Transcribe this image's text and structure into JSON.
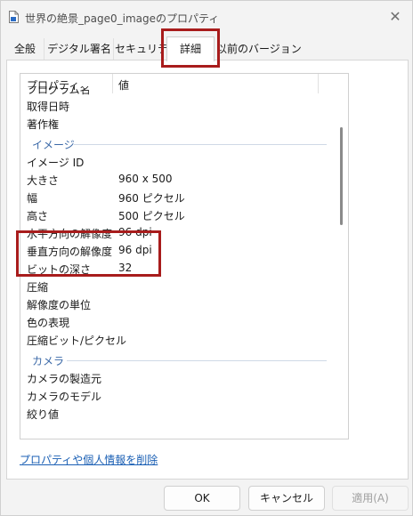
{
  "window": {
    "title": "世界の絶景_page0_imageのプロパティ",
    "close_glyph": "✕"
  },
  "tabs": [
    {
      "label": "全般"
    },
    {
      "label": "デジタル署名"
    },
    {
      "label": "セキュリティ"
    },
    {
      "label": "詳細",
      "active": true
    },
    {
      "label": "以前のバージョン"
    }
  ],
  "list": {
    "columns": [
      "プロパティ",
      "値"
    ],
    "partial_top": "プログラム名",
    "rows_a": [
      {
        "key": "取得日時",
        "value": ""
      },
      {
        "key": "著作権",
        "value": ""
      }
    ],
    "section_image": "イメージ",
    "rows_b": [
      {
        "key": "イメージ ID",
        "value": ""
      },
      {
        "key": "大きさ",
        "value": "960 x 500"
      },
      {
        "key": "幅",
        "value": "960 ピクセル"
      },
      {
        "key": "高さ",
        "value": "500 ピクセル"
      },
      {
        "key": "水平方向の解像度",
        "value": "96 dpi"
      },
      {
        "key": "垂直方向の解像度",
        "value": "96 dpi"
      },
      {
        "key": "ビットの深さ",
        "value": "32"
      },
      {
        "key": "圧縮",
        "value": ""
      },
      {
        "key": "解像度の単位",
        "value": ""
      },
      {
        "key": "色の表現",
        "value": ""
      },
      {
        "key": "圧縮ビット/ピクセル",
        "value": ""
      }
    ],
    "section_camera": "カメラ",
    "rows_c": [
      {
        "key": "カメラの製造元",
        "value": ""
      },
      {
        "key": "カメラのモデル",
        "value": ""
      },
      {
        "key": "絞り値",
        "value": ""
      }
    ]
  },
  "link": {
    "label": "プロパティや個人情報を削除"
  },
  "buttons": {
    "ok": "OK",
    "cancel": "キャンセル",
    "apply": "適用(A)"
  },
  "colors": {
    "highlight": "#a81c1c",
    "section_text": "#3c6aa8",
    "link": "#1a5fb4"
  }
}
